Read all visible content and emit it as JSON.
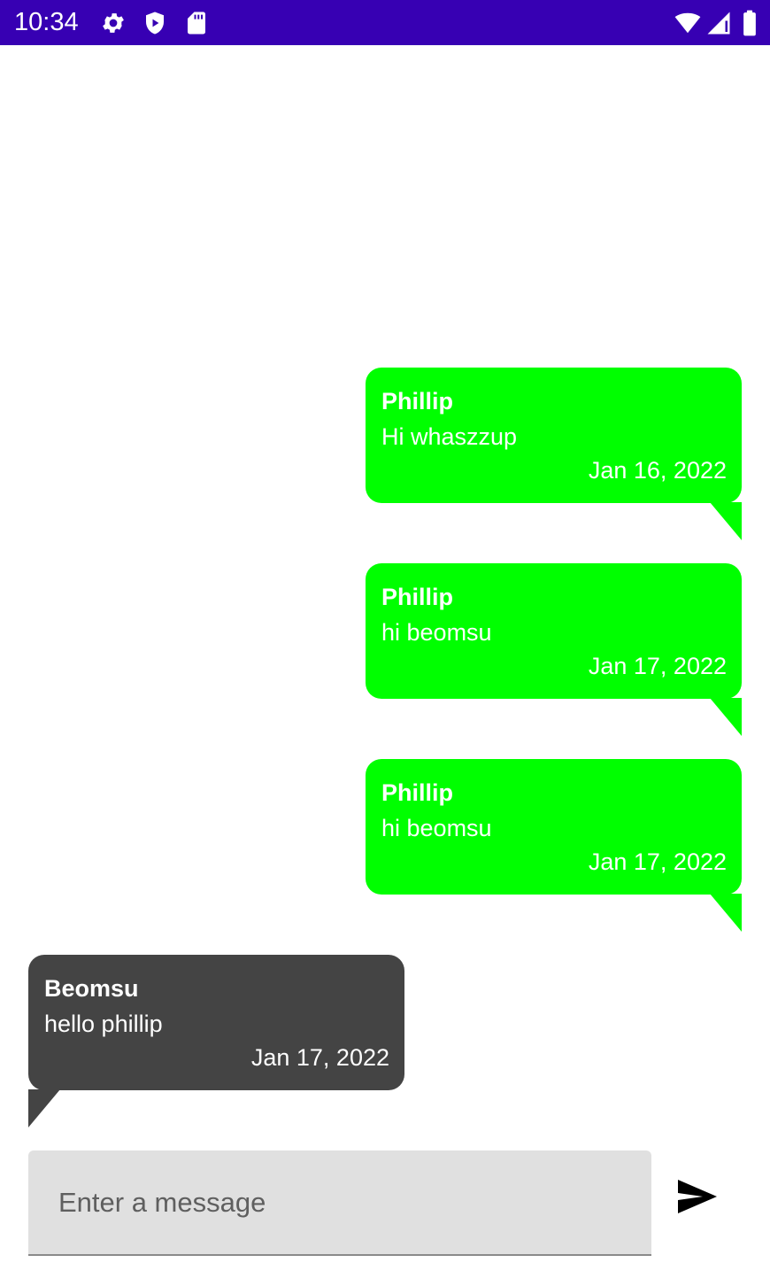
{
  "status_bar": {
    "time": "10:34",
    "left_icons": [
      "gear-icon",
      "shield-icon",
      "sd-card-icon"
    ],
    "right_icons": [
      "wifi-icon",
      "cell-signal-icon",
      "battery-icon"
    ],
    "background_color": "#3700b3"
  },
  "messages": [
    {
      "direction": "sent",
      "sender": "Phillip",
      "text": "Hi whaszzup",
      "date": "Jan 16, 2022"
    },
    {
      "direction": "sent",
      "sender": "Phillip",
      "text": "hi beomsu",
      "date": "Jan 17, 2022"
    },
    {
      "direction": "sent",
      "sender": "Phillip",
      "text": "hi beomsu",
      "date": "Jan 17, 2022"
    },
    {
      "direction": "received",
      "sender": "Beomsu",
      "text": "hello phillip",
      "date": "Jan 17, 2022"
    }
  ],
  "composer": {
    "placeholder": "Enter a message",
    "value": "",
    "send_icon": "send-icon"
  },
  "colors": {
    "sent_bubble": "#00ff00",
    "received_bubble": "#444444",
    "input_background": "#e0e0e0"
  }
}
